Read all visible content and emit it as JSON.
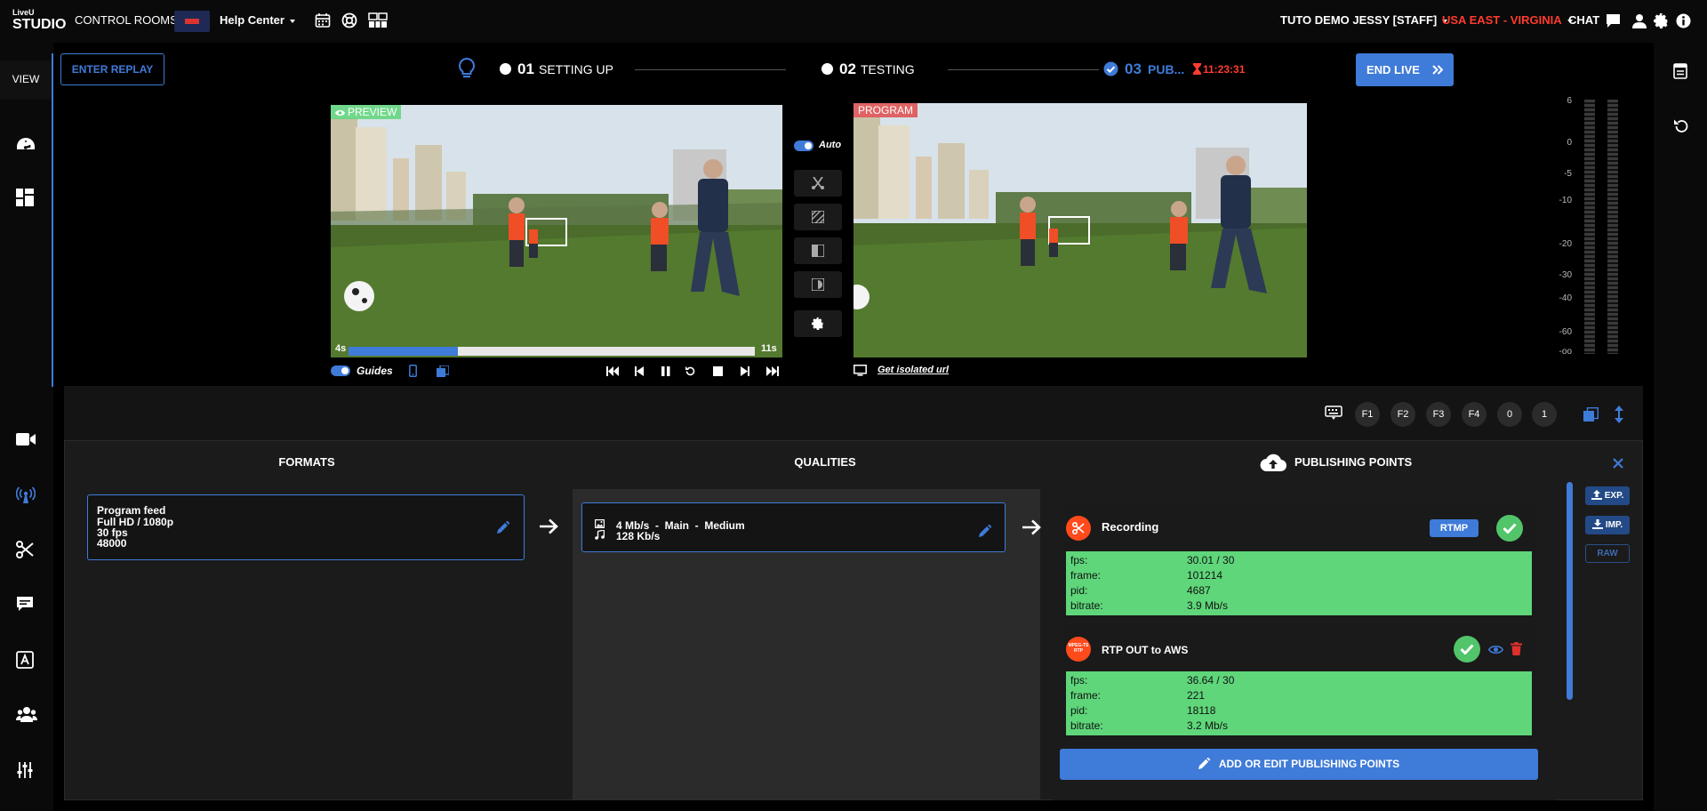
{
  "topbar": {
    "logo_top": "LiveU",
    "logo_bottom": "STUDIO",
    "control_rooms": "CONTROL ROOMS",
    "help_center": "Help Center",
    "user": "TUTO DEMO JESSY [STAFF]",
    "region": "USA EAST - VIRGINIA",
    "chat": "CHAT"
  },
  "sidebar": {
    "view_label": "VIEW"
  },
  "toolbar": {
    "enter_replay": "ENTER REPLAY",
    "end_live": "END LIVE"
  },
  "steps": [
    {
      "num": "01",
      "label": "SETTING UP"
    },
    {
      "num": "02",
      "label": "TESTING"
    },
    {
      "num": "03",
      "label": "PUB...",
      "timer": "11:23:31"
    }
  ],
  "preview": {
    "tag": "PREVIEW",
    "time_start": "4s",
    "time_end": "11s",
    "progress": 0.27,
    "guides_label": "Guides"
  },
  "program": {
    "tag": "PROGRAM",
    "isolated_url": "Get isolated url"
  },
  "transition": {
    "auto_label": "Auto"
  },
  "meter": {
    "labels": [
      "6",
      "0",
      "-5",
      "-10",
      "-20",
      "-30",
      "-40",
      "-60",
      "-oo"
    ]
  },
  "fkeys": [
    "F1",
    "F2",
    "F3",
    "F4",
    "0",
    "1"
  ],
  "columns": {
    "formats": "FORMATS",
    "qualities": "QUALITIES",
    "publishing": "PUBLISHING POINTS"
  },
  "format": {
    "name": "Program feed",
    "resolution": "Full HD / 1080p",
    "fps": "30 fps",
    "audio": "48000"
  },
  "quality": {
    "video": "4 Mb/s  -  Main  -  Medium",
    "audio": "128 Kb/s"
  },
  "publishing_points": [
    {
      "name": "Recording",
      "badge": "RTMP",
      "stats": [
        {
          "key": "fps:",
          "value": "30.01 / 30"
        },
        {
          "key": "frame:",
          "value": "101214"
        },
        {
          "key": "pid:",
          "value": "4687"
        },
        {
          "key": "bitrate:",
          "value": "3.9 Mb/s"
        }
      ]
    },
    {
      "name": "RTP OUT to AWS",
      "icon_text": "MPEG-TS RTP",
      "stats": [
        {
          "key": "fps:",
          "value": "36.64 / 30"
        },
        {
          "key": "frame:",
          "value": "221"
        },
        {
          "key": "pid:",
          "value": "18118"
        },
        {
          "key": "bitrate:",
          "value": "3.2 Mb/s"
        }
      ]
    }
  ],
  "add_edit_label": "ADD OR EDIT PUBLISHING POINTS",
  "side_buttons": {
    "export": "EXP.",
    "import": "IMP.",
    "raw": "RAW"
  },
  "colors": {
    "accent": "#3f7bd8",
    "success": "#5fd67a",
    "danger": "#ff3b2f",
    "preview_tag": "#5fd67a",
    "program_tag": "#e05555"
  }
}
